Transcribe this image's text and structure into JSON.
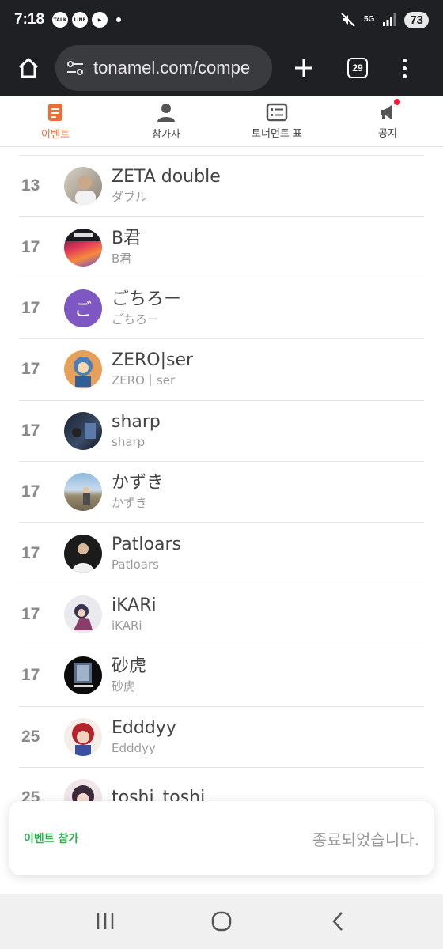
{
  "status_bar": {
    "time": "7:18",
    "app_badges": [
      "TALK",
      "LINE"
    ],
    "network": "5G",
    "battery": "73"
  },
  "browser": {
    "url": "tonamel.com/compe",
    "tab_count": "29"
  },
  "tabs": [
    {
      "label": "이벤트",
      "active": true
    },
    {
      "label": "참가자",
      "active": false
    },
    {
      "label": "토너먼트 표",
      "active": false
    },
    {
      "label": "공지",
      "active": false
    }
  ],
  "participants": [
    {
      "rank": "13",
      "name": "ZETA double",
      "sub": "ダブル"
    },
    {
      "rank": "17",
      "name": "B君",
      "sub": "B君"
    },
    {
      "rank": "17",
      "name": "ごちろー",
      "sub": "ごちろー",
      "avatar_text": "ご"
    },
    {
      "rank": "17",
      "name": "ZERO|ser",
      "sub": "ZERO｜ser"
    },
    {
      "rank": "17",
      "name": "sharp",
      "sub": "sharp"
    },
    {
      "rank": "17",
      "name": "かずき",
      "sub": "かずき"
    },
    {
      "rank": "17",
      "name": "Patloars",
      "sub": "Patloars"
    },
    {
      "rank": "17",
      "name": "iKARi",
      "sub": "iKARi"
    },
    {
      "rank": "17",
      "name": "砂虎",
      "sub": "砂虎"
    },
    {
      "rank": "25",
      "name": "Edddyy",
      "sub": "Edddyy"
    },
    {
      "rank": "25",
      "name": "toshi_toshi",
      "sub": ""
    }
  ],
  "join_card": {
    "join_label": "이벤트 참가",
    "status_label": "종료되었습니다."
  },
  "colors": {
    "accent": "#ef6c35",
    "join_green": "#2bb24c",
    "notif_red": "#e5203c"
  }
}
